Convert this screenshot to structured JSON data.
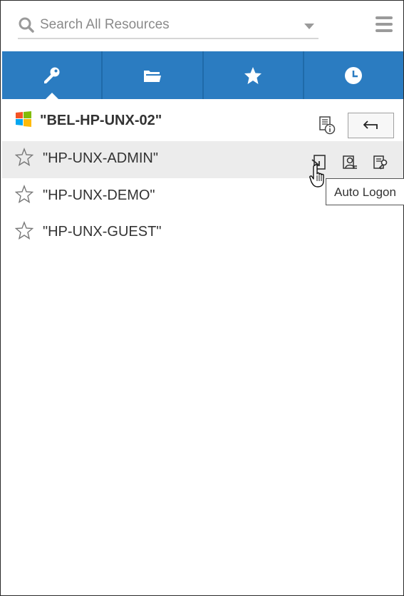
{
  "search": {
    "placeholder": "Search All Resources",
    "value": "",
    "icon": "search-icon",
    "dropdown_icon": "caret-down-icon"
  },
  "menu_icon": "hamburger-menu-icon",
  "tabs": [
    {
      "icon": "key-icon",
      "active": true
    },
    {
      "icon": "folders-icon",
      "active": false
    },
    {
      "icon": "star-icon",
      "active": false
    },
    {
      "icon": "clock-icon",
      "active": false
    }
  ],
  "resource": {
    "title": "\"BEL-HP-UNX-02\"",
    "os_icon": "windows-logo-icon",
    "info_icon": "resource-info-icon",
    "back_icon": "back-arrow-icon"
  },
  "accounts": [
    {
      "label": "\"HP-UNX-ADMIN\"",
      "favorite": false,
      "hovered": true
    },
    {
      "label": "\"HP-UNX-DEMO\"",
      "favorite": false,
      "hovered": false
    },
    {
      "label": "\"HP-UNX-GUEST\"",
      "favorite": false,
      "hovered": false
    }
  ],
  "row_actions": [
    {
      "icon": "auto-logon-icon"
    },
    {
      "icon": "user-details-icon"
    },
    {
      "icon": "password-key-icon"
    }
  ],
  "tooltip": {
    "text": "Auto Logon"
  },
  "colors": {
    "tab_bar": "#2b7cc1",
    "tab_divider": "#1f6aa9",
    "hover_row": "#ececec",
    "windows_red": "#f35325",
    "windows_green": "#81bc06",
    "windows_blue": "#05a6f0",
    "windows_yellow": "#ffba08"
  }
}
